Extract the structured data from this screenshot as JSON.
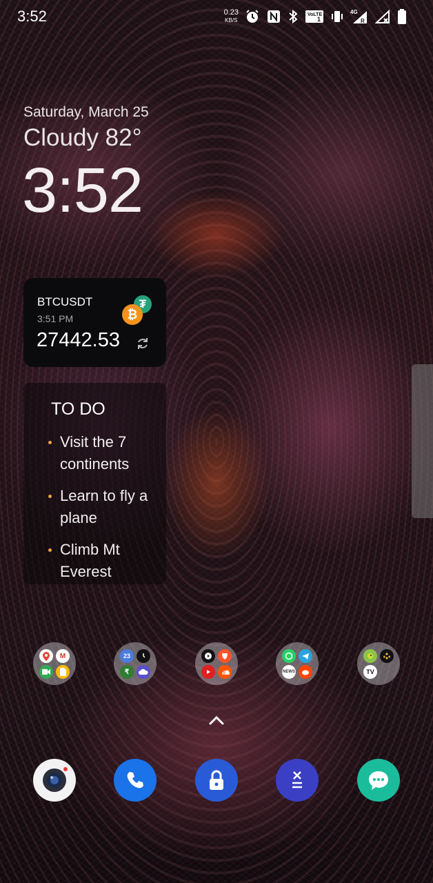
{
  "status_bar": {
    "time": "3:52",
    "net_speed": "0.23",
    "net_unit": "KB/S",
    "network_type": "4G",
    "icons": [
      "alarm-icon",
      "nfc-icon",
      "bluetooth-icon",
      "volte-icon",
      "vibrate-icon",
      "signal-icon",
      "wifi-off-icon",
      "battery-icon"
    ]
  },
  "lockscreen": {
    "date": "Saturday, March 25",
    "weather": "Cloudy 82°",
    "clock": "3:52"
  },
  "crypto_widget": {
    "symbol": "BTCUSDT",
    "time": "3:51 PM",
    "price": "27442.53",
    "icons": [
      "bitcoin-icon",
      "tether-icon",
      "refresh-icon"
    ]
  },
  "todo_widget": {
    "title": "TO DO",
    "items": [
      "Visit the 7 continents",
      "Learn to fly a plane",
      "Climb Mt Everest"
    ]
  },
  "folders": [
    {
      "name": "google-apps-folder",
      "apps": [
        "maps-icon",
        "gmail-icon",
        "meet-icon",
        "files-icon"
      ]
    },
    {
      "name": "utilities-folder",
      "apps": [
        "calendar-icon",
        "clock-icon",
        "payments-icon",
        "weather-icon"
      ],
      "calendar_day": "23"
    },
    {
      "name": "media-folder",
      "apps": [
        "player-icon",
        "brave-icon",
        "youtube-icon",
        "soundcloud-icon"
      ]
    },
    {
      "name": "social-folder",
      "apps": [
        "whatsapp-icon",
        "telegram-icon",
        "news-icon",
        "reddit-icon"
      ]
    },
    {
      "name": "trading-folder",
      "apps": [
        "parrot-icon",
        "binance-icon",
        "tradingview-icon",
        "empty-slot"
      ]
    }
  ],
  "dock": [
    "camera-icon",
    "phone-icon",
    "lock-icon",
    "calculator-icon",
    "messages-icon"
  ],
  "colors": {
    "bitcoin": "#f7931a",
    "tether": "#26a17b",
    "todo_bullet": "#e8a24a",
    "phone": "#1a73e8",
    "lock": "#2a5bd7",
    "calculator": "#3b3fc4",
    "messages": "#1abc9c"
  }
}
